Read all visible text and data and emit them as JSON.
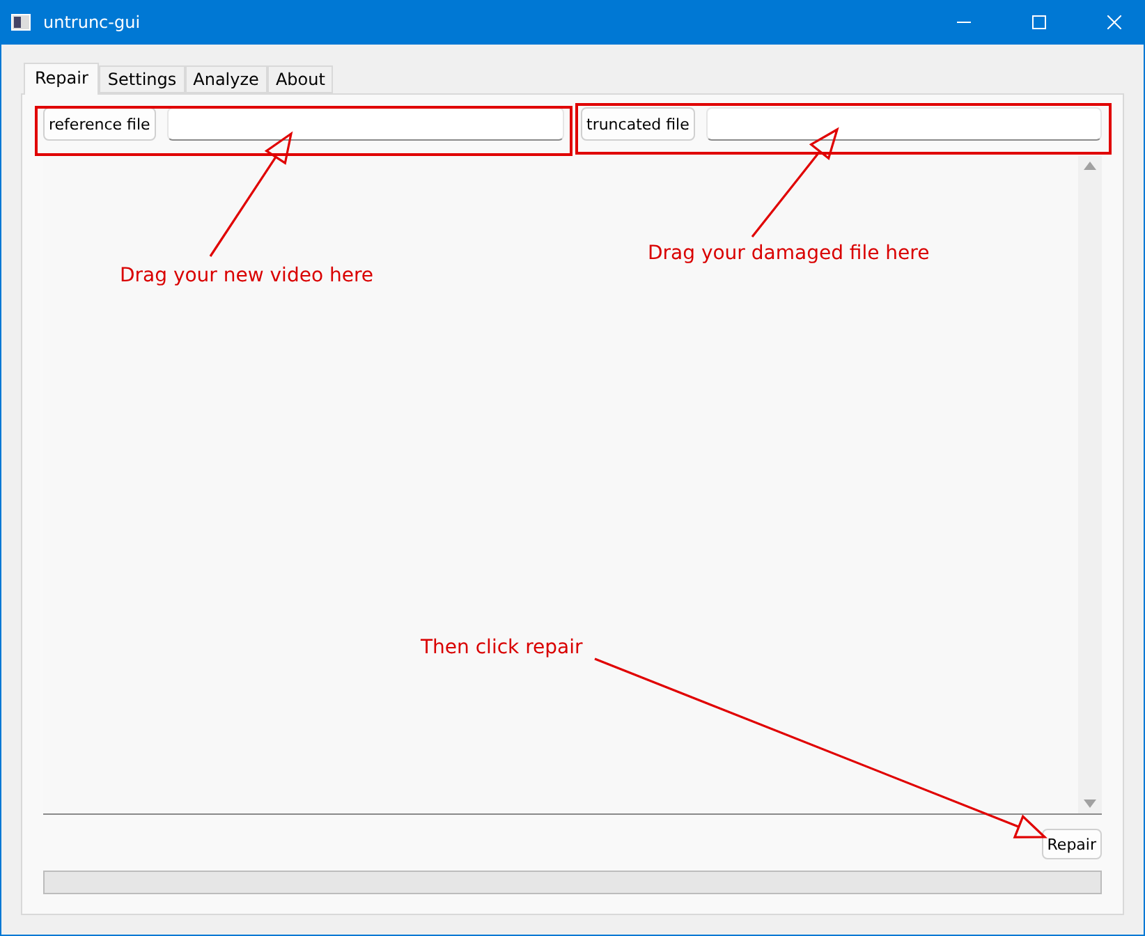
{
  "window": {
    "title": "untrunc-gui"
  },
  "tabs": [
    {
      "label": "Repair",
      "selected": true
    },
    {
      "label": "Settings",
      "selected": false
    },
    {
      "label": "Analyze",
      "selected": false
    },
    {
      "label": "About",
      "selected": false
    }
  ],
  "file_pickers": [
    {
      "button": "reference file"
    },
    {
      "button": "truncated file"
    }
  ],
  "repair_button": "Repair",
  "progress": {
    "level": 0
  },
  "annotations": [
    "Drag your new video here",
    "Drag your damaged file here",
    "Then click repair"
  ]
}
